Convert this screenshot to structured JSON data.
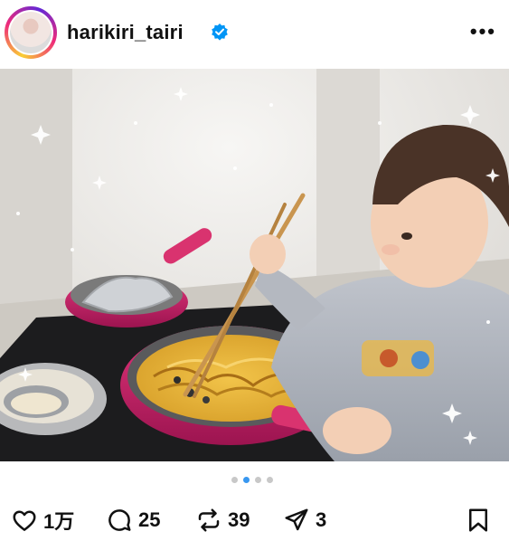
{
  "post": {
    "username": "harikiri_tairi",
    "verified_icon": "verified-badge-icon",
    "more_icon": "more-options-icon",
    "more_text": "•••"
  },
  "photo": {
    "description_icon": "post-photo"
  },
  "carousel": {
    "count": 4,
    "active_index": 1
  },
  "actions": {
    "likes": "1万",
    "comments": "25",
    "reposts": "39",
    "shares": "3"
  },
  "colors": {
    "accent": "#3897f0",
    "verified": "#0095f6",
    "pan": "#c2185b"
  }
}
